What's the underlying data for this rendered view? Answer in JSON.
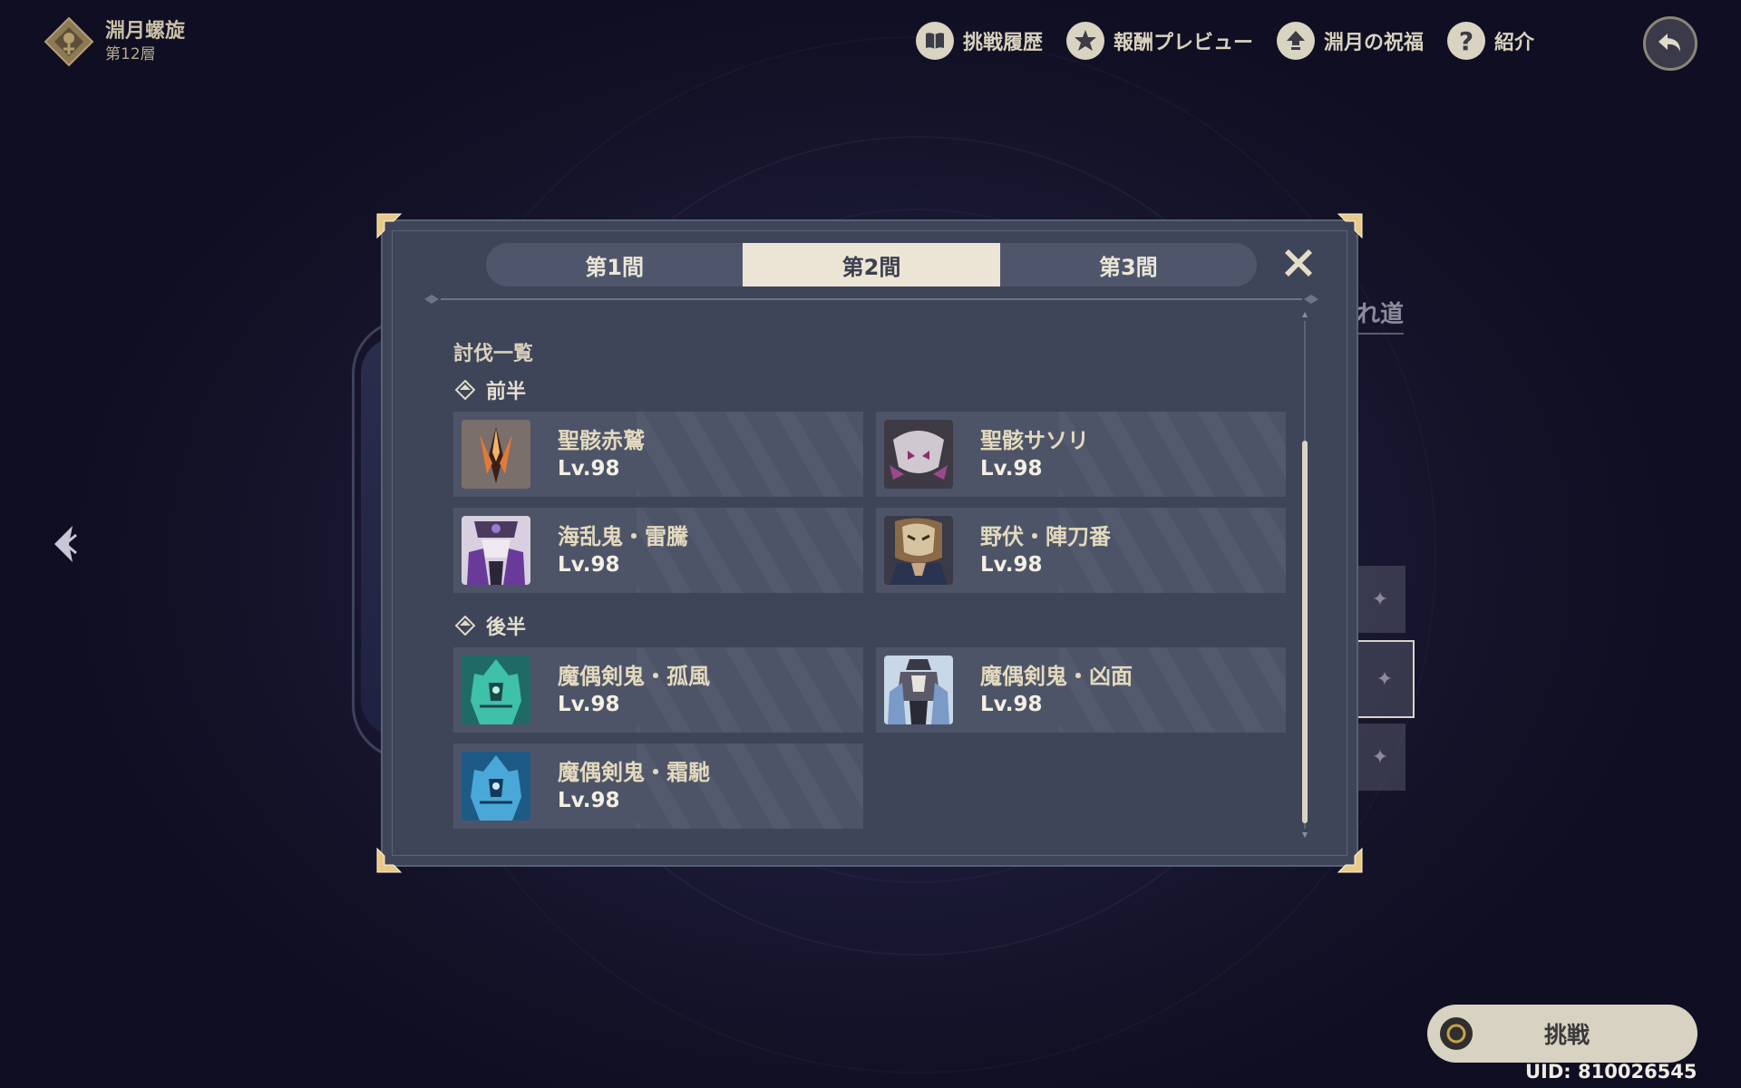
{
  "header": {
    "title": "淵月螺旋",
    "floor": "第12層"
  },
  "top_menu": {
    "items": [
      {
        "label": "挑戦履歴",
        "icon": "book-icon"
      },
      {
        "label": "報酬プレビュー",
        "icon": "star-badge-icon"
      },
      {
        "label": "淵月の祝福",
        "icon": "up-arrow-icon"
      },
      {
        "label": "紹介",
        "icon": "question-icon"
      }
    ],
    "back_icon": "back-arrow-icon"
  },
  "background": {
    "route_text": "れ道",
    "star_symbol": "✦"
  },
  "modal": {
    "tabs": [
      {
        "label": "第1間",
        "active": false
      },
      {
        "label": "第2間",
        "active": true
      },
      {
        "label": "第3間",
        "active": false
      }
    ],
    "section_title": "討伐一覧",
    "groups": [
      {
        "label": "前半",
        "enemies": [
          {
            "name": "聖骸赤鷲",
            "level": "Lv.98"
          },
          {
            "name": "聖骸サソリ",
            "level": "Lv.98"
          },
          {
            "name": "海乱鬼・雷騰",
            "level": "Lv.98"
          },
          {
            "name": "野伏・陣刀番",
            "level": "Lv.98"
          }
        ]
      },
      {
        "label": "後半",
        "enemies": [
          {
            "name": "魔偶剣鬼・孤風",
            "level": "Lv.98"
          },
          {
            "name": "魔偶剣鬼・凶面",
            "level": "Lv.98"
          },
          {
            "name": "魔偶剣鬼・霜馳",
            "level": "Lv.98"
          }
        ]
      }
    ]
  },
  "footer": {
    "challenge_label": "挑戦",
    "uid": "UID: 810026545"
  },
  "colors": {
    "accent_gold": "#c9a45c",
    "tab_active_bg": "#ece5d6",
    "modal_bg": "#3f4558"
  }
}
